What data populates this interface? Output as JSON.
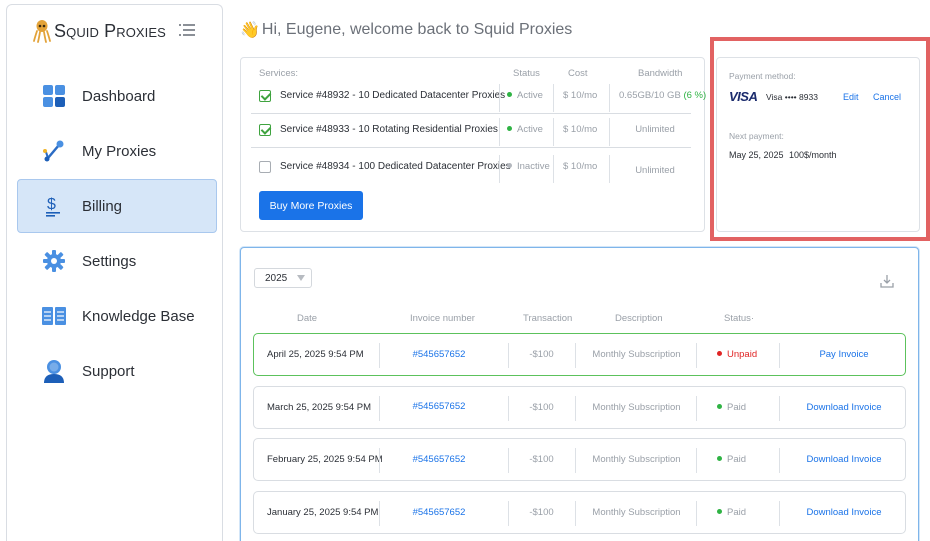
{
  "app": {
    "brand": "Squid Proxies"
  },
  "sidebar": {
    "items": [
      {
        "label": "Dashboard",
        "icon": "dashboard-grid-icon",
        "active": false
      },
      {
        "label": "My Proxies",
        "icon": "proxies-network-icon",
        "active": false
      },
      {
        "label": "Billing",
        "icon": "dollar-icon",
        "active": true
      },
      {
        "label": "Settings",
        "icon": "gear-icon",
        "active": false
      },
      {
        "label": "Knowledge Base",
        "icon": "book-icon",
        "active": false
      },
      {
        "label": "Support",
        "icon": "user-support-icon",
        "active": false
      }
    ]
  },
  "header": {
    "greeting": "Hi, Eugene, welcome back to Squid Proxies"
  },
  "services": {
    "headers": {
      "services": "Services:",
      "status": "Status",
      "cost": "Cost",
      "bandwidth": "Bandwidth"
    },
    "rows": [
      {
        "checked": true,
        "name": "Service #48932 - 10 Dedicated Datacenter Proxies",
        "status": "Active",
        "cost": "$ 10/mo",
        "bandwidth": "0.65GB/10 GB",
        "bandwidth_pct": "(6 %)"
      },
      {
        "checked": true,
        "name": "Service #48933 - 10 Rotating Residential Proxies",
        "status": "Active",
        "cost": "$ 10/mo",
        "bandwidth": "Unlimited",
        "bandwidth_pct": ""
      },
      {
        "checked": false,
        "name": "Service #48934 - 100 Dedicated Datacenter Proxies",
        "status": "Inactive",
        "cost": "$ 10/mo",
        "bandwidth": "Unlimited",
        "bandwidth_pct": ""
      }
    ],
    "buy_label": "Buy More Proxies"
  },
  "payment": {
    "method_label": "Payment method:",
    "card_brand": "VISA",
    "card_number": "Visa •••• 8933",
    "edit_label": "Edit",
    "cancel_label": "Cancel",
    "next_label": "Next payment:",
    "next_date": "May 25, 2025",
    "next_amount": "100$/month"
  },
  "invoices": {
    "year": "2025",
    "headers": {
      "date": "Date",
      "number": "Invoice number",
      "transaction": "Transaction",
      "description": "Description",
      "status": "Status·"
    },
    "rows": [
      {
        "date": "April 25, 2025  9:54 PM",
        "number": "#545657652",
        "transaction": "-$100",
        "description": "Monthly Subscription",
        "status": "Unpaid",
        "action": "Pay Invoice"
      },
      {
        "date": "March 25, 2025 9:54 PM",
        "number": "#545657652",
        "transaction": "-$100",
        "description": "Monthly Subscription",
        "status": "Paid",
        "action": "Download Invoice"
      },
      {
        "date": "February 25, 2025 9:54 PM",
        "number": "#545657652",
        "transaction": "-$100",
        "description": "Monthly Subscription",
        "status": "Paid",
        "action": "Download Invoice"
      },
      {
        "date": "January 25, 2025 9:54 PM",
        "number": "#545657652",
        "transaction": "-$100",
        "description": "Monthly Subscription",
        "status": "Paid",
        "action": "Download Invoice"
      }
    ]
  },
  "colors": {
    "accent": "#1a73e8",
    "active_nav": "#d6e6f8",
    "paid": "#2fb344",
    "unpaid": "#e02424",
    "highlight": "#e26262"
  }
}
